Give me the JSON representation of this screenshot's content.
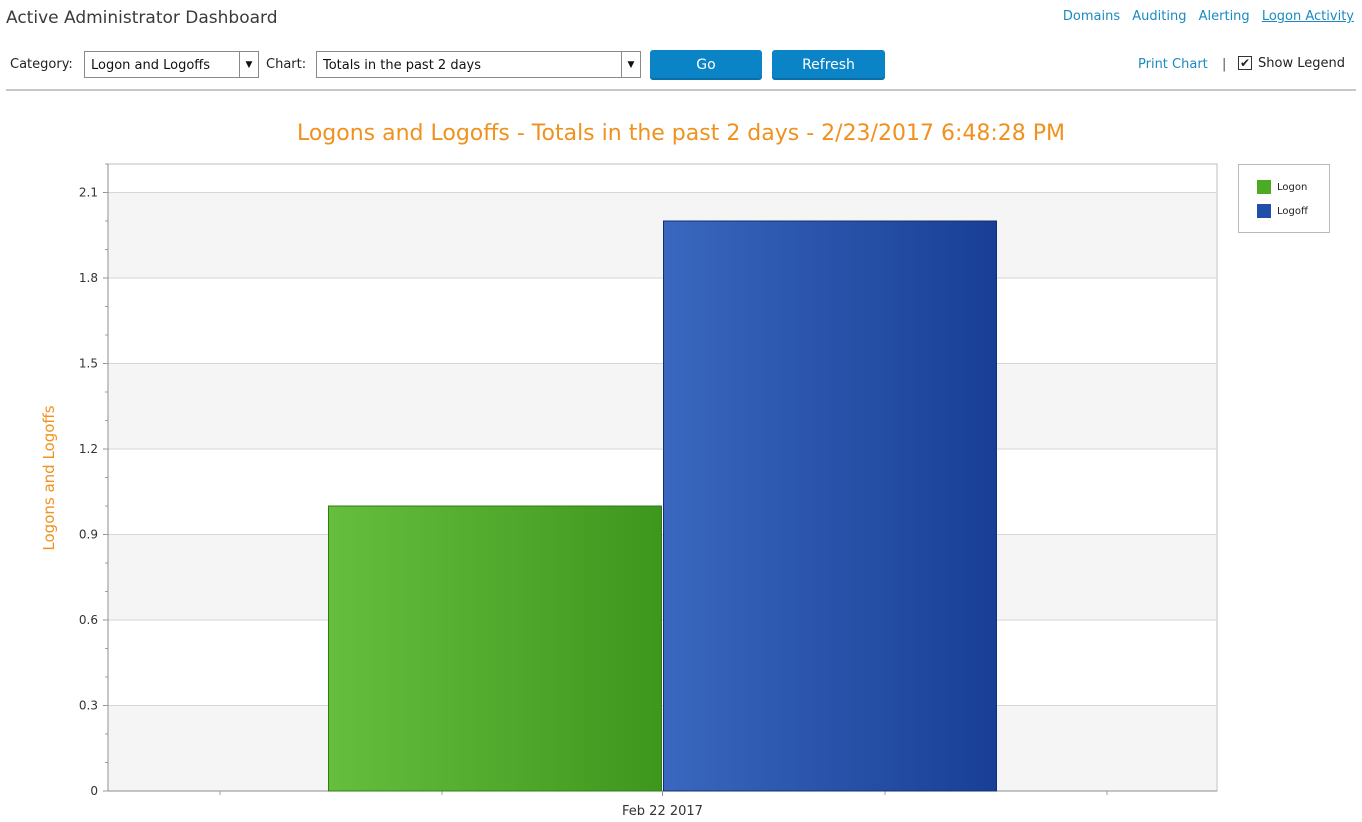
{
  "app": {
    "title": "Active Administrator Dashboard"
  },
  "nav": {
    "links": [
      {
        "label": "Domains",
        "active": false
      },
      {
        "label": "Auditing",
        "active": false
      },
      {
        "label": "Alerting",
        "active": false
      },
      {
        "label": "Logon Activity",
        "active": true
      }
    ]
  },
  "toolbar": {
    "category_label": "Category:",
    "category_value": "Logon and Logoffs",
    "chart_label": "Chart:",
    "chart_value": "Totals in the past 2 days",
    "go_label": "Go",
    "refresh_label": "Refresh",
    "print_label": "Print Chart",
    "separator": "|",
    "show_legend_label": "Show Legend",
    "show_legend_checked": true
  },
  "chart_data": {
    "type": "bar",
    "title": "Logons and Logoffs - Totals in the past 2 days - 2/23/2017 6:48:28 PM",
    "xlabel": "",
    "ylabel": "Logons and Logoffs",
    "categories": [
      "Feb 22 2017"
    ],
    "series": [
      {
        "name": "Logon",
        "values": [
          1
        ],
        "color": "#4aac22"
      },
      {
        "name": "Logoff",
        "values": [
          2
        ],
        "color": "#1f4fa8"
      }
    ],
    "ylim": [
      0,
      2.2
    ],
    "yticks": [
      "0",
      "0.3",
      "0.6",
      "0.9",
      "1.2",
      "1.5",
      "1.8",
      "2.1"
    ],
    "grid": true,
    "legend": "right"
  }
}
